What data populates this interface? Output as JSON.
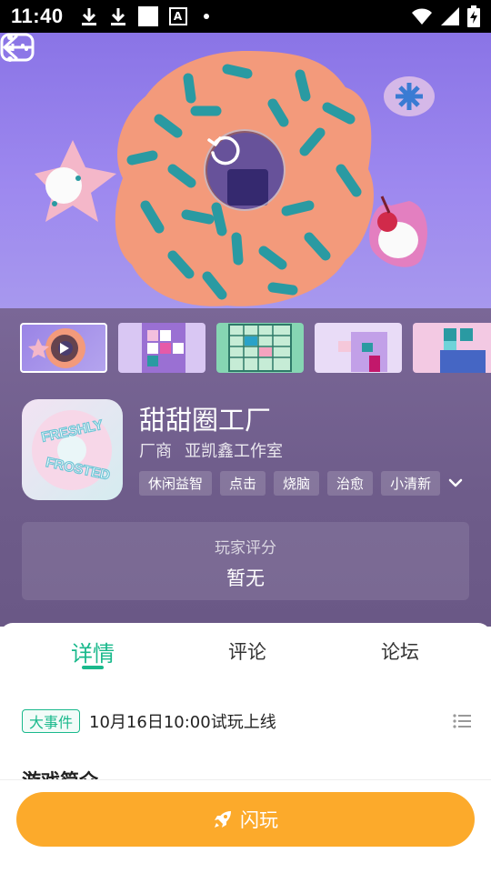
{
  "status_bar": {
    "time": "11:40",
    "icons": [
      "download-icon",
      "download-icon",
      "blank-square-icon",
      "font-a-icon",
      "dot-icon",
      "wifi-icon",
      "signal-icon",
      "battery-charging-icon"
    ]
  },
  "hero": {
    "icons": [
      "back-arrow-icon",
      "gamepad-icon",
      "more-vert-icon",
      "replay-icon"
    ]
  },
  "thumbnails": [
    {
      "label": "video",
      "selected": true,
      "icon": "play-icon"
    },
    {
      "label": "screenshot-1",
      "selected": false
    },
    {
      "label": "screenshot-2",
      "selected": false
    },
    {
      "label": "screenshot-3",
      "selected": false
    },
    {
      "label": "screenshot-4",
      "selected": false
    }
  ],
  "app": {
    "title": "甜甜圈工厂",
    "vendor_label": "厂商",
    "vendor_name": "亚凯鑫工作室",
    "tags": [
      "休闲益智",
      "点击",
      "烧脑",
      "治愈",
      "小清新"
    ],
    "icon_lettering": [
      "FRESHLY",
      "FROSTED"
    ]
  },
  "rating": {
    "label": "玩家评分",
    "value": "暂无"
  },
  "tabs": [
    {
      "label": "详情",
      "active": true
    },
    {
      "label": "评论",
      "active": false
    },
    {
      "label": "论坛",
      "active": false
    }
  ],
  "event": {
    "badge": "大事件",
    "text": "10月16日10:00试玩上线"
  },
  "section": {
    "title": "游戏简介"
  },
  "action": {
    "play_label": "闪玩"
  },
  "colors": {
    "accent_green": "#1ab98c",
    "play_orange": "#fcaa2b",
    "hero_purple": "#8a74e6",
    "panel_purple": "#6e5c8a"
  }
}
